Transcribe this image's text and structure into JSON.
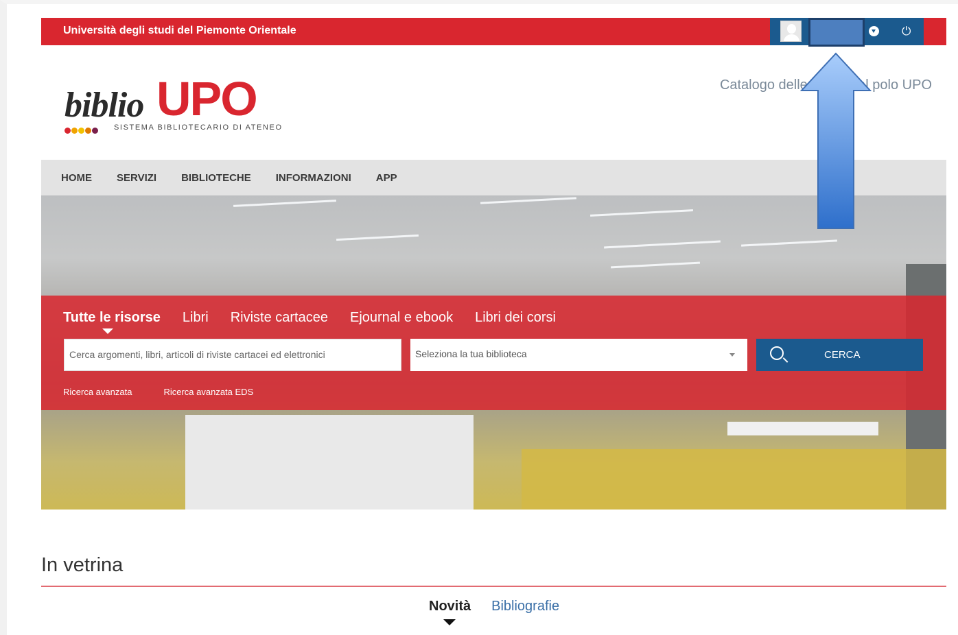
{
  "topbar": {
    "university": "Università degli studi del Piemonte Orientale",
    "user_menu_icon": "chevron-down-icon",
    "logout_icon": "power-icon"
  },
  "logo": {
    "biblio": "biblio",
    "upo": "UPO",
    "tagline": "SISTEMA BIBLIOTECARIO DI ATENEO",
    "dot_colors": [
      "#d9262f",
      "#f0a300",
      "#f2c200",
      "#e07b00",
      "#7a1f4b"
    ]
  },
  "catalog_text": "Catalogo delle Bib       al polo UPO",
  "nav": {
    "items": [
      "HOME",
      "SERVIZI",
      "BIBLIOTECHE",
      "INFORMAZIONI",
      "APP"
    ]
  },
  "search": {
    "tabs": [
      "Tutte le risorse",
      "Libri",
      "Riviste cartacee",
      "Ejournal e ebook",
      "Libri dei corsi"
    ],
    "input_placeholder": "Cerca argomenti, libri, articoli di riviste cartacei ed elettronici",
    "library_select": "Seleziona la tua biblioteca",
    "button_label": "CERCA",
    "advanced": [
      "Ricerca avanzata",
      "Ricerca avanzata EDS"
    ]
  },
  "vetrina": {
    "title": "In vetrina",
    "tabs": [
      "Novità",
      "Bibliografie"
    ]
  },
  "colors": {
    "brand_red": "#d9262f",
    "brand_blue": "#1b5a8e",
    "annotation_arrow": "#6fa3ea"
  }
}
